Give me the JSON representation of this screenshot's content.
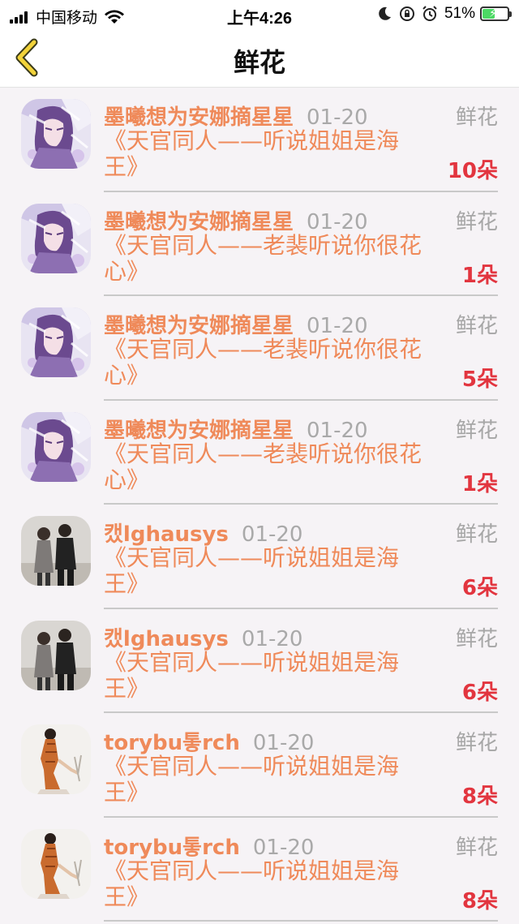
{
  "status_bar": {
    "carrier": "中国移动",
    "time": "上午4:26",
    "battery_percent": "51%",
    "battery_level": 0.51,
    "icons": [
      "signal-icon",
      "wifi-icon",
      "moon-icon",
      "rotation-lock-icon",
      "alarm-icon",
      "battery-icon"
    ]
  },
  "nav": {
    "title": "鲜花",
    "back_icon": "chevron-left-icon"
  },
  "records": [
    {
      "user": "墨曦想为安娜摘星星",
      "date": "01-20",
      "type": "鲜花",
      "book": "《天官同人——听说姐姐是海王》",
      "count": "10朵",
      "avatar": "anime-girl-avatar"
    },
    {
      "user": "墨曦想为安娜摘星星",
      "date": "01-20",
      "type": "鲜花",
      "book": "《天官同人——老裴听说你很花心》",
      "count": "1朵",
      "avatar": "anime-girl-avatar"
    },
    {
      "user": "墨曦想为安娜摘星星",
      "date": "01-20",
      "type": "鲜花",
      "book": "《天官同人——老裴听说你很花心》",
      "count": "5朵",
      "avatar": "anime-girl-avatar"
    },
    {
      "user": "墨曦想为安娜摘星星",
      "date": "01-20",
      "type": "鲜花",
      "book": "《天官同人——老裴听说你很花心》",
      "count": "1朵",
      "avatar": "anime-girl-avatar"
    },
    {
      "user": "캤lghausys",
      "date": "01-20",
      "type": "鲜花",
      "book": "《天官同人——听说姐姐是海王》",
      "count": "6朵",
      "avatar": "couple-photo-avatar"
    },
    {
      "user": "캤lghausys",
      "date": "01-20",
      "type": "鲜花",
      "book": "《天官同人——听说姐姐是海王》",
      "count": "6朵",
      "avatar": "couple-photo-avatar"
    },
    {
      "user": "torybu톻rch",
      "date": "01-20",
      "type": "鲜花",
      "book": "《天官同人——听说姐姐是海王》",
      "count": "8朵",
      "avatar": "woman-qipao-avatar"
    },
    {
      "user": "torybu톻rch",
      "date": "01-20",
      "type": "鲜花",
      "book": "《天官同人——听说姐姐是海王》",
      "count": "8朵",
      "avatar": "woman-qipao-avatar"
    }
  ]
}
